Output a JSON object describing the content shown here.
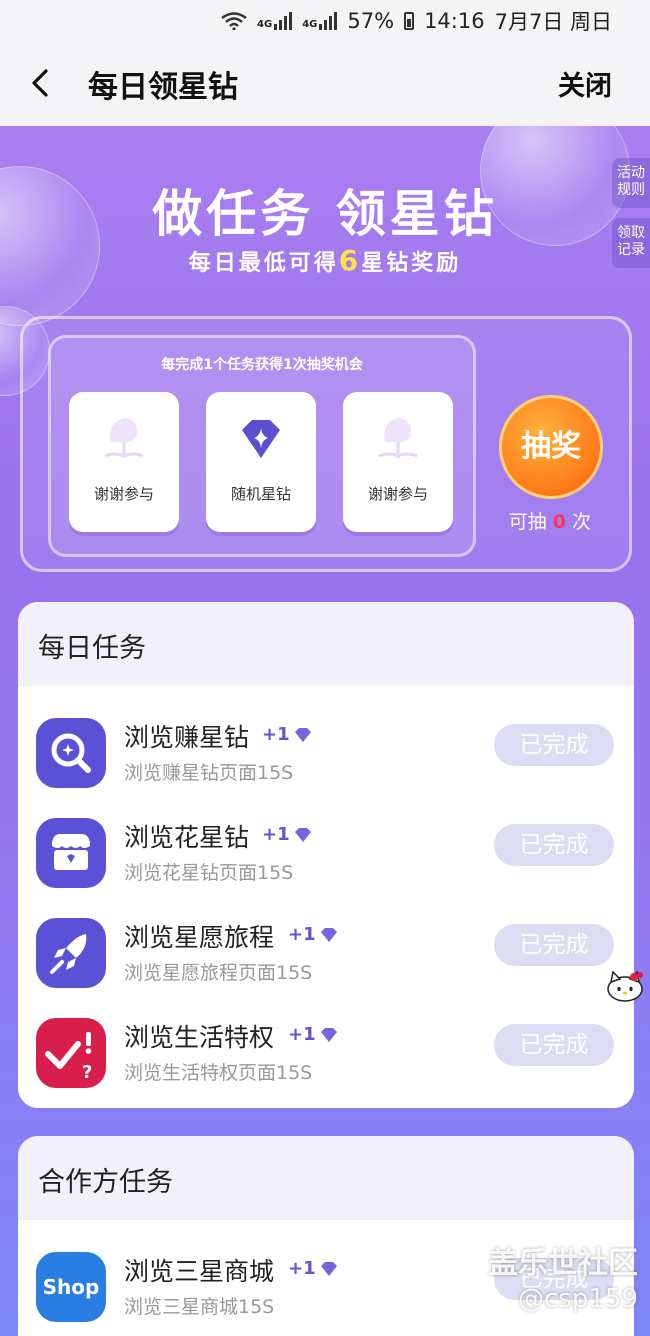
{
  "status_bar": {
    "network1": "4G",
    "network2": "4G",
    "battery": "57%",
    "time": "14:16",
    "date": "7月7日 周日"
  },
  "app_bar": {
    "title": "每日领星钻",
    "close_label": "关闭",
    "back_icon": "chevron-left-icon"
  },
  "hero": {
    "title": "做任务 领星钻",
    "subtitle_pre": "每日最低可得",
    "subtitle_num": "6",
    "subtitle_post": "星钻奖励",
    "side_tabs": [
      "活动规则",
      "领取记录"
    ]
  },
  "lottery": {
    "hint": "每完成1个任务获得1次抽奖机会",
    "prizes": [
      "谢谢参与",
      "随机星钻",
      "谢谢参与"
    ],
    "draw_label": "抽奖",
    "count_pre": "可抽",
    "count": "0",
    "count_post": "次"
  },
  "daily_tasks": {
    "heading": "每日任务",
    "items": [
      {
        "name": "浏览赚星钻",
        "reward": "+1",
        "desc": "浏览赚星钻页面15S",
        "status": "已完成",
        "icon": "search-icon"
      },
      {
        "name": "浏览花星钻",
        "reward": "+1",
        "desc": "浏览花星钻页面15S",
        "status": "已完成",
        "icon": "store-icon"
      },
      {
        "name": "浏览星愿旅程",
        "reward": "+1",
        "desc": "浏览星愿旅程页面15S",
        "status": "已完成",
        "icon": "rocket-icon"
      },
      {
        "name": "浏览生活特权",
        "reward": "+1",
        "desc": "浏览生活特权页面15S",
        "status": "已完成",
        "icon": "checklist-icon"
      }
    ]
  },
  "partner_tasks": {
    "heading": "合作方任务",
    "items": [
      {
        "name": "浏览三星商城",
        "reward": "+1",
        "desc": "浏览三星商城15S",
        "status": "已完成",
        "icon": "shop-icon",
        "icon_text": "Shop"
      }
    ]
  },
  "watermark": {
    "line1": "盖乐世社区",
    "line2": "@csp159"
  },
  "colors": {
    "accent": "#6a4fd0",
    "task_icon_bg": "#5a52d6",
    "life_icon_bg": "#d81e4a",
    "shop_icon_bg": "#2a7de1",
    "done_button": "#dcdcf2"
  }
}
